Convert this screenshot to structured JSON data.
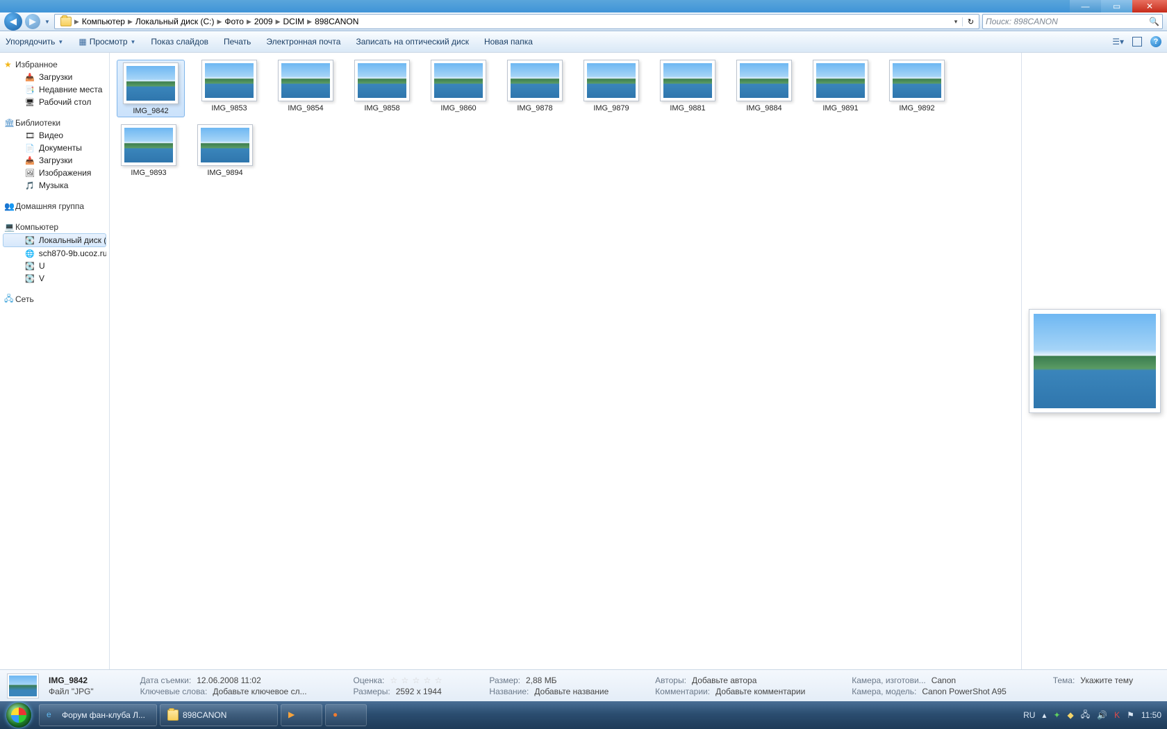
{
  "breadcrumb": [
    "Компьютер",
    "Локальный диск (C:)",
    "Фото",
    "2009",
    "DCIM",
    "898CANON"
  ],
  "search_placeholder": "Поиск: 898CANON",
  "toolbar": {
    "organize": "Упорядочить",
    "preview": "Просмотр",
    "slideshow": "Показ слайдов",
    "print": "Печать",
    "email": "Электронная почта",
    "burn": "Записать на оптический диск",
    "newfolder": "Новая папка"
  },
  "sidebar": {
    "favorites": {
      "head": "Избранное",
      "items": [
        "Загрузки",
        "Недавние места",
        "Рабочий стол"
      ]
    },
    "libraries": {
      "head": "Библиотеки",
      "items": [
        "Видео",
        "Документы",
        "Загрузки",
        "Изображения",
        "Музыка"
      ]
    },
    "homegroup": {
      "head": "Домашняя группа"
    },
    "computer": {
      "head": "Компьютер",
      "items": [
        "Локальный диск (C",
        "sch870-9b.ucoz.ru",
        "U",
        "V"
      ]
    },
    "network": {
      "head": "Сеть"
    }
  },
  "files": [
    "IMG_9842",
    "IMG_9853",
    "IMG_9854",
    "IMG_9858",
    "IMG_9860",
    "IMG_9878",
    "IMG_9879",
    "IMG_9881",
    "IMG_9884",
    "IMG_9891",
    "IMG_9892",
    "IMG_9893",
    "IMG_9894"
  ],
  "selected_index": 0,
  "details": {
    "name": "IMG_9842",
    "type": "Файл \"JPG\"",
    "date_label": "Дата съемки:",
    "date": "12.06.2008 11:02",
    "keywords_label": "Ключевые слова:",
    "keywords": "Добавьте ключевое сл...",
    "rating_label": "Оценка:",
    "size_label": "Размер:",
    "size": "2,88 МБ",
    "dims_label": "Размеры:",
    "dims": "2592 x 1944",
    "title_label": "Название:",
    "title": "Добавьте название",
    "authors_label": "Авторы:",
    "authors": "Добавьте автора",
    "comments_label": "Комментарии:",
    "comments": "Добавьте комментарии",
    "maker_label": "Камера, изготови...",
    "maker": "Canon",
    "model_label": "Камера, модель:",
    "model": "Canon PowerShot A95",
    "subject_label": "Тема:",
    "subject": "Укажите тему"
  },
  "taskbar": {
    "task1": "Форум фан-клуба Л...",
    "task2": "898CANON",
    "lang": "RU",
    "time": "11:50"
  }
}
